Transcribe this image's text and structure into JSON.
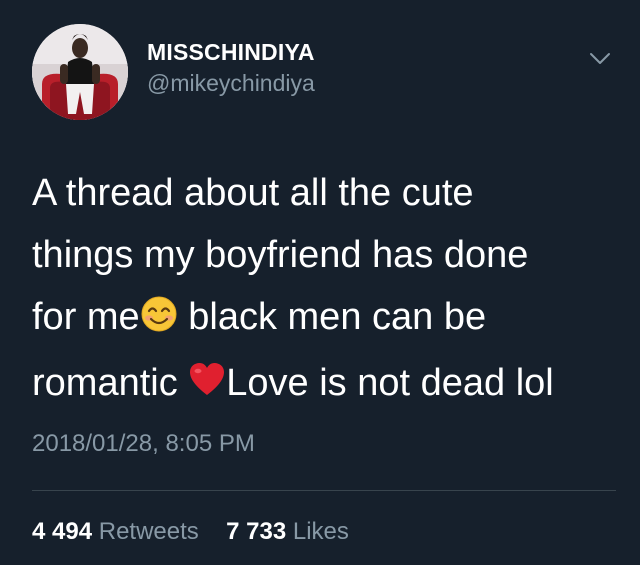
{
  "user": {
    "display_name": "MISSCHINDIYA",
    "handle": "@mikeychindiya"
  },
  "tweet": {
    "line1": "A thread about all the cute",
    "line2": "things my boyfriend has done",
    "line3_before_emoji": "for me",
    "line3_after_emoji": " black men can be",
    "line4_before_emoji": "romantic ",
    "line4_after_emoji": "Love is not dead lol",
    "emojis": [
      "smiling-face-emoji",
      "red-heart-emoji"
    ]
  },
  "timestamp": "2018/01/28, 8:05 PM",
  "stats": {
    "retweets_count": "4 494",
    "retweets_label": "Retweets",
    "likes_count": "7 733",
    "likes_label": "Likes"
  },
  "colors": {
    "background": "#16202c",
    "secondary_text": "#8899a6",
    "divider": "#38444d"
  }
}
